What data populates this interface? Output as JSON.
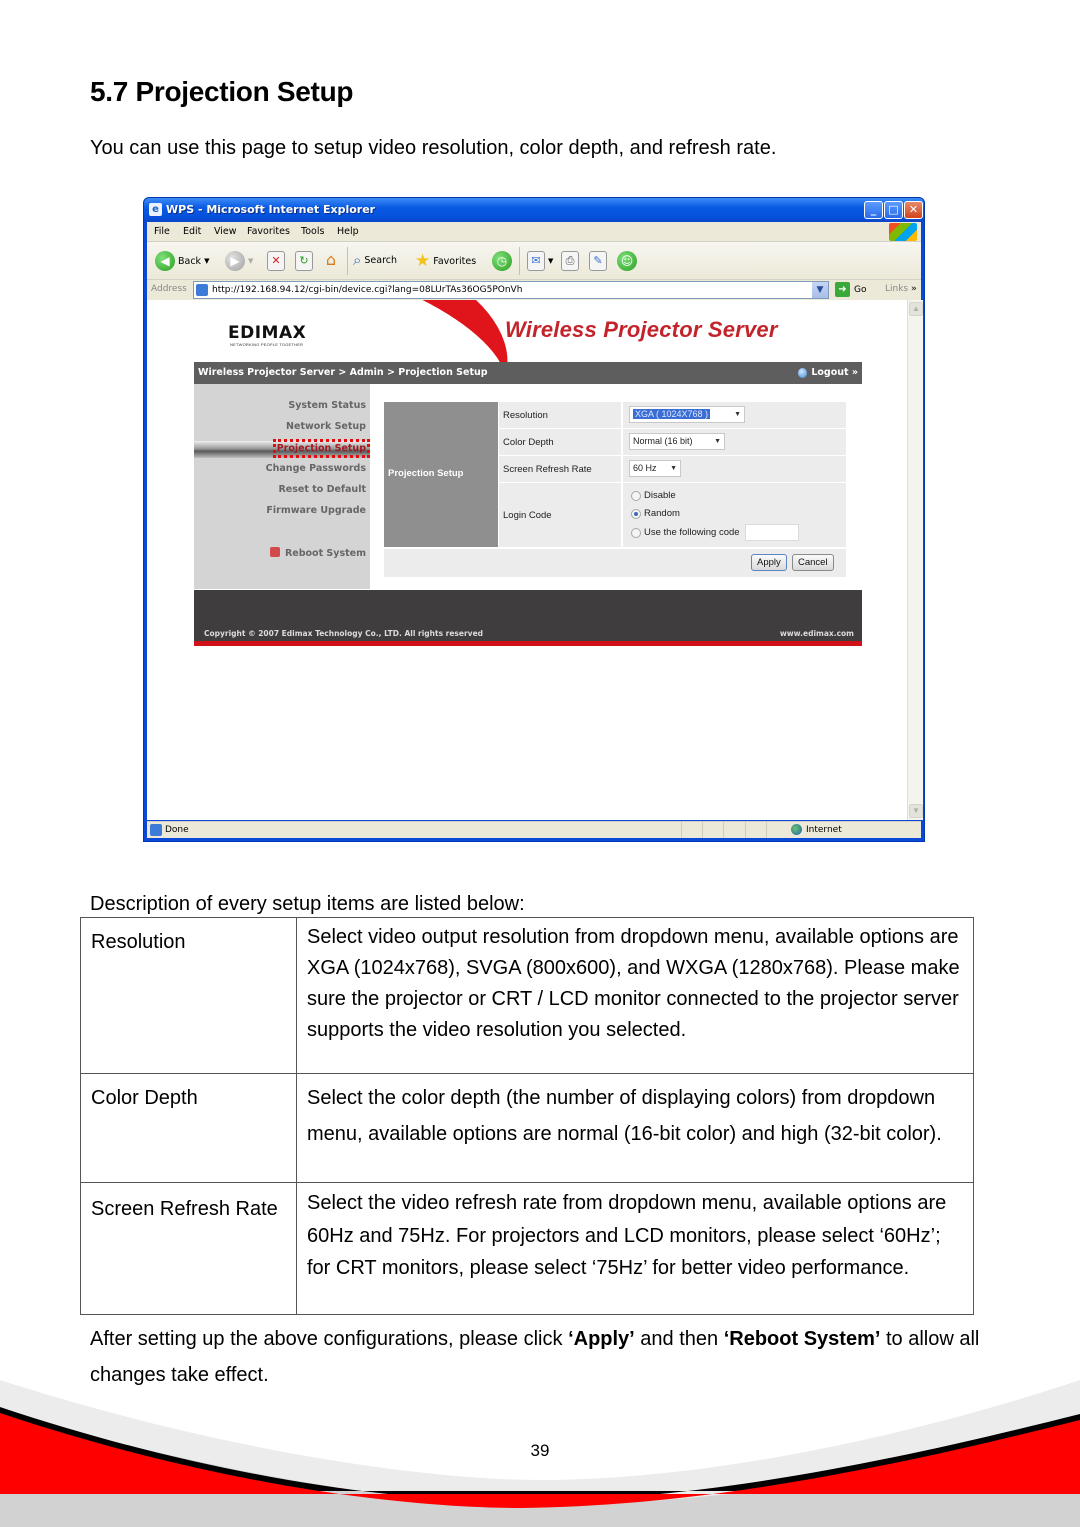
{
  "heading": "5.7 Projection Setup",
  "intro": "You can use this page to setup video resolution, color depth, and refresh rate.",
  "browser": {
    "title": "WPS - Microsoft Internet Explorer",
    "menu": [
      "File",
      "Edit",
      "View",
      "Favorites",
      "Tools",
      "Help"
    ],
    "toolbar": {
      "back": "Back",
      "search": "Search",
      "favorites": "Favorites"
    },
    "address_label": "Address",
    "url": "http://192.168.94.12/cgi-bin/device.cgi?lang=08LUrTAs36OG5POnVh",
    "go": "Go",
    "links": "Links",
    "status": "Done",
    "zone": "Internet"
  },
  "webpage": {
    "logo": "EDIMAX",
    "logo_tagline": "NETWORKING PEOPLE TOGETHER",
    "product_title": "Wireless Projector Server",
    "breadcrumb": "Wireless Projector Server > Admin > Projection Setup",
    "logout": "Logout »",
    "nav": [
      {
        "label": "System Status"
      },
      {
        "label": "Network Setup"
      },
      {
        "label": "Projection Setup",
        "active": true
      },
      {
        "label": "Change Passwords"
      },
      {
        "label": "Reset to Default"
      },
      {
        "label": "Firmware Upgrade"
      },
      {
        "label": "Reboot System"
      }
    ],
    "section_label": "Projection Setup",
    "form": {
      "resolution": {
        "label": "Resolution",
        "value": "XGA ( 1024X768 )"
      },
      "color_depth": {
        "label": "Color Depth",
        "value": "Normal (16 bit)"
      },
      "refresh_rate": {
        "label": "Screen Refresh Rate",
        "value": "60 Hz"
      },
      "login_code": {
        "label": "Login Code",
        "options": [
          "Disable",
          "Random",
          "Use the following code"
        ],
        "selected": "Random",
        "code_value": ""
      }
    },
    "apply": "Apply",
    "cancel": "Cancel",
    "copyright": "Copyright © 2007 Edimax Technology Co., LTD. All rights reserved",
    "site": "www.edimax.com"
  },
  "description_lead": "Description of every setup items are listed below:",
  "description_table": [
    {
      "item": "Resolution",
      "text": "Select video output resolution from dropdown menu, available options are XGA (1024x768), SVGA (800x600), and WXGA (1280x768). Please make sure the projector or CRT / LCD monitor connected to the projector server supports the video resolution you selected."
    },
    {
      "item": "Color Depth",
      "text": "Select the color depth (the number of displaying colors) from dropdown menu, available options are normal (16-bit color) and high (32-bit color)."
    },
    {
      "item": "Screen Refresh Rate",
      "text": "Select the video refresh rate from dropdown menu, available options are 60Hz and 75Hz. For projectors and LCD monitors, please select ‘60Hz’; for CRT monitors, please select ‘75Hz’ for better video performance."
    }
  ],
  "after": {
    "pre": "After setting up the above configurations, please click ",
    "apply": "‘Apply’",
    "mid": " and then ",
    "reboot": "‘Reboot System’",
    "post": " to allow all changes take effect."
  },
  "page_number": "39",
  "colors": {
    "accent_red": "#ff0000",
    "ie_blue": "#0a48d8",
    "header_gray": "#5e5e5e"
  }
}
